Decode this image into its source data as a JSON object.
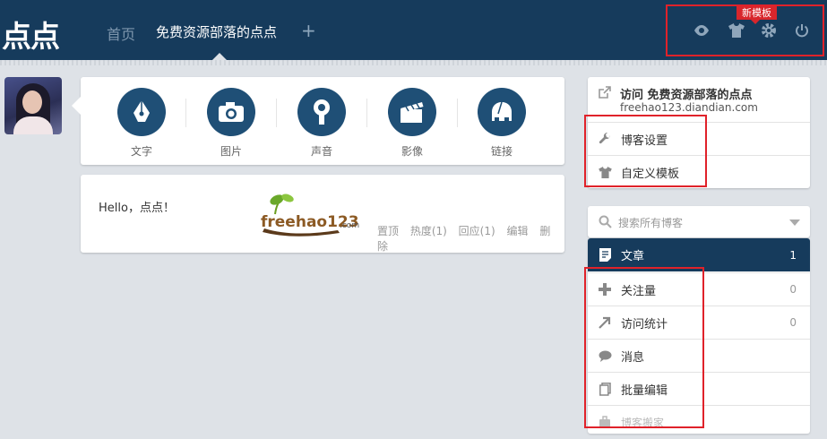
{
  "header": {
    "logo": "点点",
    "nav_home": "首页",
    "nav_blog": "免费资源部落的点点",
    "nav_add": "+",
    "badge": "新模板",
    "icons": [
      "eye-icon",
      "shirt-icon",
      "gear-icon",
      "power-icon"
    ]
  },
  "post_types": [
    {
      "label": "文字",
      "icon": "pen-nib-icon"
    },
    {
      "label": "图片",
      "icon": "camera-icon"
    },
    {
      "label": "声音",
      "icon": "microphone-icon"
    },
    {
      "label": "影像",
      "icon": "clapperboard-icon"
    },
    {
      "label": "链接",
      "icon": "link-icon"
    }
  ],
  "post": {
    "text": "Hello，点点！",
    "image_text": "freehao123",
    "image_suffix": ".com",
    "actions": [
      "置顶",
      "热度(1)",
      "回应(1)",
      "编辑",
      "删除"
    ]
  },
  "sidebar": {
    "visit_title": "访问 免费资源部落的点点",
    "visit_url": "freehao123.diandian.com",
    "settings": [
      {
        "label": "博客设置",
        "icon": "wrench-icon"
      },
      {
        "label": "自定义模板",
        "icon": "shirt-icon"
      }
    ],
    "search_placeholder": "搜索所有博客",
    "menu": [
      {
        "label": "文章",
        "count": "1",
        "icon": "article-icon"
      },
      {
        "label": "关注量",
        "count": "0",
        "icon": "plus-icon"
      },
      {
        "label": "访问统计",
        "count": "0",
        "icon": "trend-arrow-icon"
      },
      {
        "label": "消息",
        "count": "",
        "icon": "speech-bubble-icon"
      },
      {
        "label": "批量编辑",
        "count": "",
        "icon": "copy-icon"
      },
      {
        "label": "博客搬家",
        "count": "",
        "icon": "luggage-icon"
      }
    ]
  },
  "colors": {
    "header_bg": "#163b5c",
    "accent": "#1f4f76",
    "highlight": "#e0222a"
  }
}
